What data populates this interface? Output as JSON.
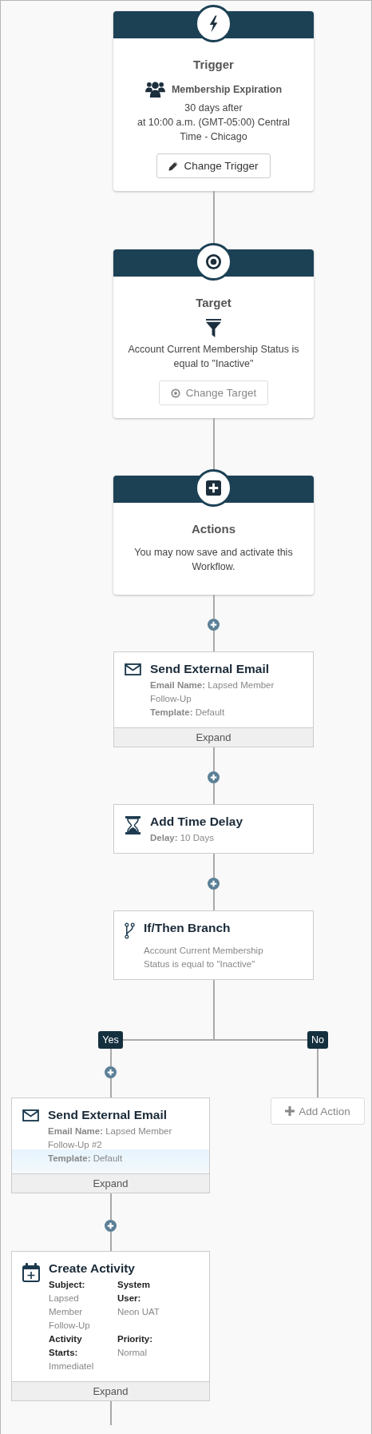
{
  "trigger": {
    "title": "Trigger",
    "event": "Membership Expiration",
    "offset": "30 days after",
    "schedule": "at 10:00 a.m. (GMT-05:00) Central Time - Chicago",
    "button": {
      "label": "Change Trigger",
      "disabled": false
    }
  },
  "target": {
    "title": "Target",
    "condition": "Account Current Membership Status is equal to \"Inactive\"",
    "button": {
      "label": "Change Target",
      "disabled": true
    }
  },
  "actions": {
    "title": "Actions",
    "message": "You may now save and activate this Workflow."
  },
  "steps": [
    {
      "kind": "email",
      "title": "Send External Email",
      "highlighted": false,
      "fields": [
        "**Email Name:** Lapsed Member Follow-Up",
        "**Template:** Default"
      ],
      "expand": "Expand"
    },
    {
      "kind": "delay",
      "title": "Add Time Delay",
      "highlighted": false,
      "fields": [
        "**Delay:** 10 Days"
      ]
    },
    {
      "kind": "branch",
      "title": "If/Then Branch",
      "highlighted": false,
      "description": "Account Current Membership Status is equal to \"Inactive\""
    }
  ],
  "branch": {
    "yes": {
      "label": "Yes",
      "steps": [
        {
          "kind": "email",
          "title": "Send External Email",
          "highlighted": true,
          "fields": [
            "**Email Name:** Lapsed Member Follow-Up #2",
            "**Template:** Default"
          ],
          "expand": "Expand"
        },
        {
          "kind": "activity",
          "title": "Create Activity",
          "highlighted": false,
          "grid": [
            {
              "label": "Subject:",
              "value": "Lapsed Member Follow-Up"
            },
            {
              "label": "System User:",
              "value": "Neon UAT"
            },
            {
              "label": "Activity Starts:",
              "value": "Immediatel"
            },
            {
              "label": "Priority:",
              "value": "Normal"
            }
          ],
          "expand": "Expand"
        }
      ]
    },
    "no": {
      "label": "No",
      "add_action": "Add Action"
    }
  }
}
